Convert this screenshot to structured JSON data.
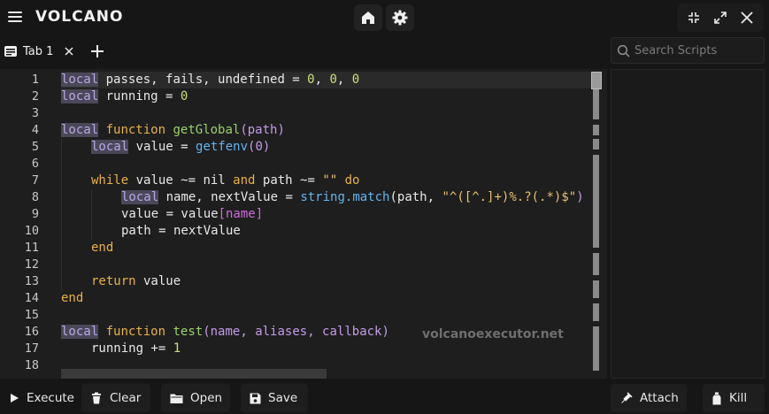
{
  "app": {
    "title": "VOLCANO",
    "icons": {
      "menu": "hamburger-icon",
      "home": "home-icon",
      "settings": "gear-icon",
      "minimize": "minimize-icon",
      "maximize": "maximize-icon",
      "close": "close-icon"
    }
  },
  "tabs": {
    "items": [
      {
        "label": "Tab 1"
      }
    ],
    "add": "+"
  },
  "editor": {
    "line_numbers": [
      "1",
      "2",
      "3",
      "4",
      "5",
      "6",
      "7",
      "8",
      "9",
      "10",
      "11",
      "12",
      "13",
      "14",
      "15",
      "16",
      "17",
      "18"
    ],
    "tokens": {
      "local": "local",
      "l1_rest": " passes, fails, undefined = ",
      "zero": "0",
      "comma": ", ",
      "l2_rest": " running = ",
      "function": "function",
      "getGlobal": "getGlobal",
      "l4_paren": "(path)",
      "l5_rest": " value = ",
      "getfenv": "getfenv",
      "l5_arg": "(0)",
      "while": "while",
      "l7_a": " value ~= nil ",
      "and": "and",
      "l7_b": " path ~= ",
      "empty_str": "\"\"",
      "do": "do",
      "l8_a": " name, nextValue = ",
      "string_match": "string.match",
      "l8_b": "(path, ",
      "pattern": "\"^([^.]+)%.?(.*)$\"",
      "close_paren": ")",
      "l9_a": "value = value",
      "l9_b": "[name]",
      "l10": "path = nextValue",
      "end": "end",
      "return": "return",
      "l13_rest": " value",
      "test": "test",
      "l16_args": "(name, aliases, callback)",
      "l17_a": "running += ",
      "one": "1"
    },
    "watermark": "volcanoexecutor.net"
  },
  "search": {
    "placeholder": "Search Scripts"
  },
  "toolbar": {
    "execute": "Execute",
    "clear": "Clear",
    "open": "Open",
    "save": "Save",
    "attach": "Attach",
    "kill": "Kill"
  }
}
